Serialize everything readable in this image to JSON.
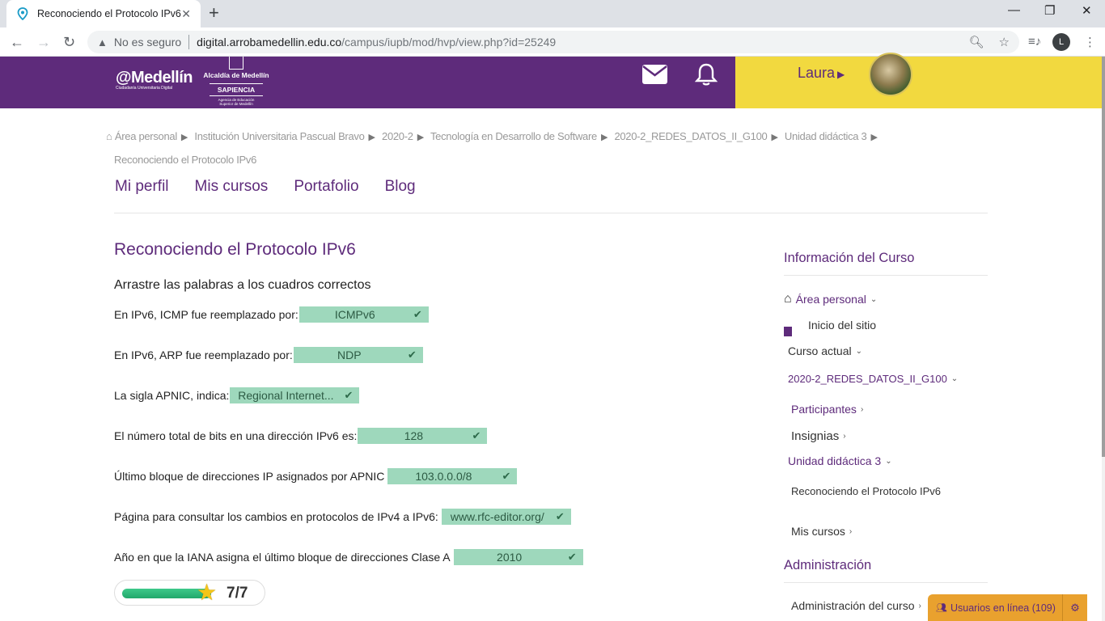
{
  "browser": {
    "tab_title": "Reconociendo el Protocolo IPv6",
    "security_label": "No es seguro",
    "url_host": "digital.arrobamedellin.edu.co",
    "url_path": "/campus/iupb/mod/hvp/view.php?id=25249",
    "profile_initial": "L"
  },
  "header": {
    "logo_main": "@Medellín",
    "logo_main_sub": "Ciudadanía Universitaria Digital",
    "logo2_line1": "Alcaldía de Medellín",
    "logo2_sap": "SAPIENCIA",
    "logo2_tiny1": "Agencia de Educación",
    "logo2_tiny2": "Superior de Medellín",
    "username": "Laura"
  },
  "breadcrumb": {
    "items": [
      "Área personal",
      "Institución Universitaria Pascual Bravo",
      "2020-2",
      "Tecnología en Desarrollo de Software",
      "2020-2_REDES_DATOS_II_G100",
      "Unidad didáctica 3"
    ],
    "last": "Reconociendo el Protocolo IPv6"
  },
  "topnav": [
    "Mi perfil",
    "Mis cursos",
    "Portafolio",
    "Blog"
  ],
  "main": {
    "title": "Reconociendo el Protocolo IPv6",
    "instruction": "Arrastre las palabras a los cuadros correctos",
    "questions": [
      {
        "text": "En IPv6, ICMP fue reemplazado por:",
        "answer": "ICMPv6"
      },
      {
        "text": "En IPv6, ARP fue reemplazado por:",
        "answer": "NDP"
      },
      {
        "text": "La sigla APNIC, indica:",
        "answer": "Regional Internet..."
      },
      {
        "text": "El número total de bits en una dirección IPv6 es:",
        "answer": "128"
      },
      {
        "text": "Último bloque de direcciones IP asignados por APNIC",
        "answer": "103.0.0.0/8"
      },
      {
        "text": "Página para consultar los cambios en protocolos de IPv4 a IPv6:",
        "answer": "www.rfc-editor.org/"
      },
      {
        "text": "Año en que la IANA asigna el último bloque de direcciones Clase A",
        "answer": "2010"
      }
    ],
    "score": "7/7",
    "score_fraction": 1.0
  },
  "sidebar": {
    "course_info_title": "Información del Curso",
    "area_personal": "Área personal",
    "inicio": "Inicio del sitio",
    "curso_actual": "Curso actual",
    "course_code": "2020-2_REDES_DATOS_II_G100",
    "participantes": "Participantes",
    "insignias": "Insignias",
    "unidad": "Unidad didáctica 3",
    "activity": "Reconociendo el Protocolo IPv6",
    "mis_cursos": "Mis cursos",
    "admin_title": "Administración",
    "admin_course": "Administración del curso",
    "online_users": "Usuarios en línea (109)"
  },
  "colors": {
    "brand_purple": "#5e2b7b",
    "brand_yellow": "#f2d93f",
    "correct_green": "#9ed8bc"
  }
}
